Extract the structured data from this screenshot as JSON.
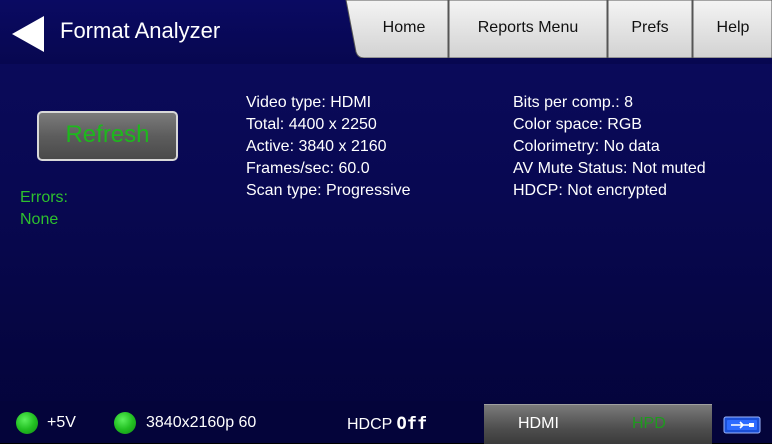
{
  "header": {
    "title": "Format Analyzer",
    "tabs": [
      "Home",
      "Reports Menu",
      "Prefs",
      "Help"
    ]
  },
  "actions": {
    "refresh_label": "Refresh"
  },
  "errors": {
    "label": "Errors:",
    "value": "None"
  },
  "info": {
    "left": [
      "Video type: HDMI",
      "Total: 4400 x 2250",
      "Active: 3840 x 2160",
      "Frames/sec: 60.0",
      "Scan type: Progressive"
    ],
    "right": [
      "Bits per comp.: 8",
      "Color space: RGB",
      "Colorimetry: No data",
      "AV Mute Status: Not muted",
      "HDCP: Not encrypted"
    ]
  },
  "status": {
    "power_label": "+5V",
    "format_label": "3840x2160p 60",
    "hdcp_label": "HDCP",
    "hdcp_state": "Off",
    "port_label": "HDMI",
    "hpd_label": "HPD",
    "led_color": "#22c022"
  },
  "icons": {
    "back": "back-arrow-icon",
    "connection": "usb-connection-icon"
  }
}
